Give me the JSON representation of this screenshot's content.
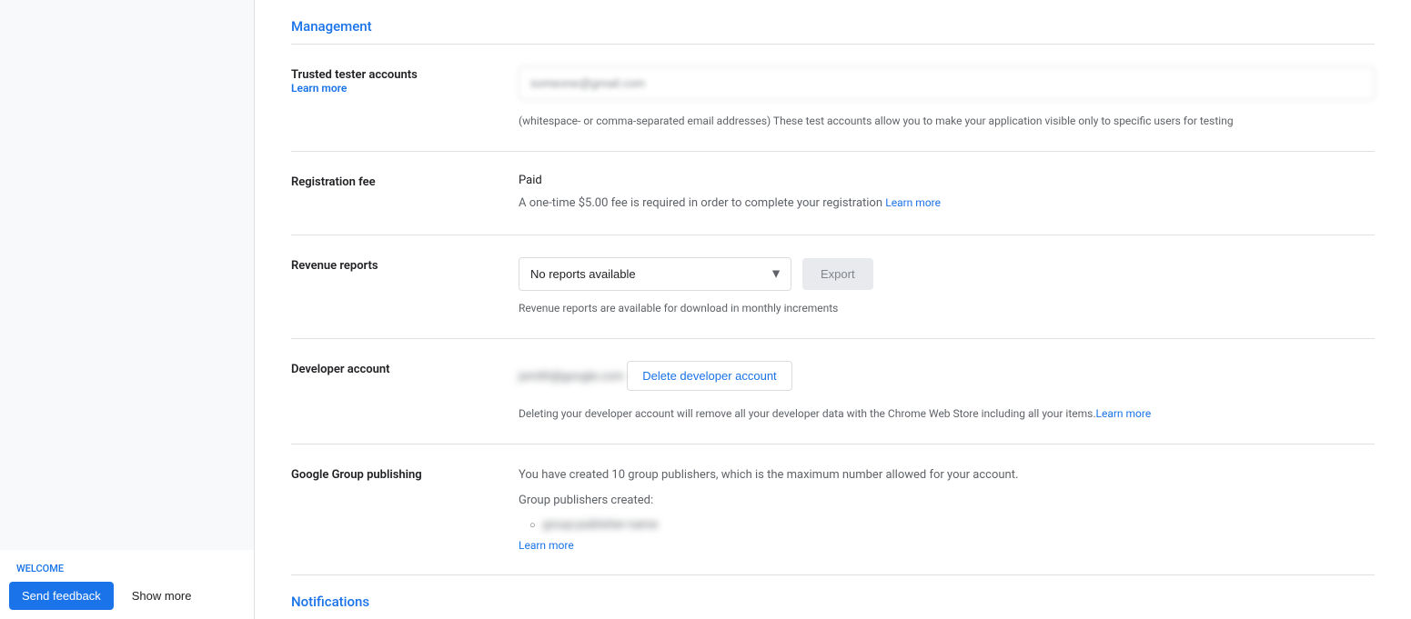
{
  "sidebar": {
    "welcome_label": "WELCOME",
    "send_feedback_label": "Send feedback",
    "show_more_label": "Show more"
  },
  "main": {
    "management_title": "Management",
    "trusted_tester": {
      "label": "Trusted tester accounts",
      "learn_more": "Learn more",
      "placeholder": "someone@gmail.com",
      "helper_text": "(whitespace- or comma-separated email addresses) These test accounts allow you to make your application visible only to specific users for testing"
    },
    "registration_fee": {
      "label": "Registration fee",
      "status": "Paid",
      "description": "A one-time $5.00 fee is required in order to complete your registration",
      "learn_more": "Learn more"
    },
    "revenue_reports": {
      "label": "Revenue reports",
      "select_value": "No reports available",
      "export_label": "Export",
      "helper_text": "Revenue reports are available for download in monthly increments"
    },
    "developer_account": {
      "label": "Developer account",
      "email": "jsmith@google.com",
      "delete_button": "Delete developer account",
      "description": "Deleting your developer account will remove all your developer data with the Chrome Web Store including all your items.",
      "learn_more": "Learn more"
    },
    "google_group_publishing": {
      "label": "Google Group publishing",
      "description_line1": "You have created 10 group publishers, which is the maximum number allowed for your account.",
      "description_line2": "Group publishers created:",
      "group_name": "group-name",
      "learn_more": "Learn more"
    },
    "notifications_title": "Notifications"
  }
}
